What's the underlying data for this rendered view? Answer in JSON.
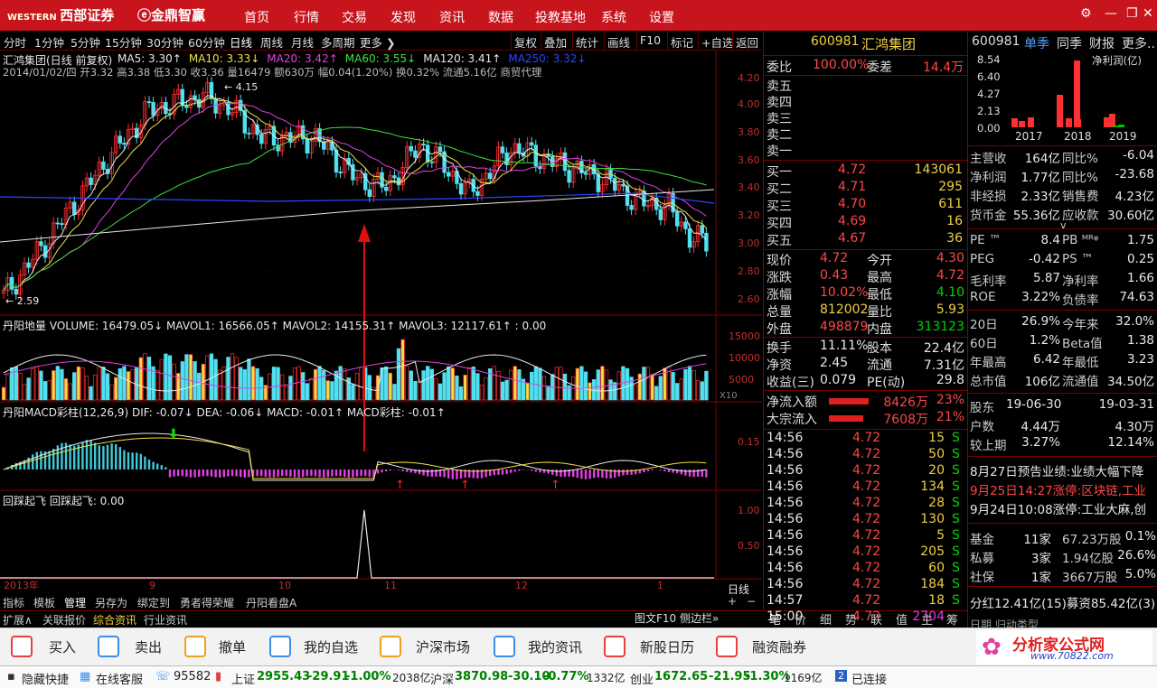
{
  "titlebar": {
    "brand1": "西部证券",
    "brand2": "金鼎智赢",
    "menus": [
      "首页",
      "行情",
      "交易",
      "发现",
      "资讯",
      "数据",
      "投教基地",
      "系统",
      "设置"
    ]
  },
  "periods": [
    "分时",
    "1分钟",
    "5分钟",
    "15分钟",
    "30分钟",
    "60分钟",
    "日线",
    "周线",
    "月线",
    "多周期",
    "更多"
  ],
  "tools": [
    "复权",
    "叠加",
    "统计",
    "画线",
    "F10",
    "标记",
    "+自选",
    "返回"
  ],
  "chart": {
    "info1": "汇鸿集团(日线 前复权)",
    "ma": [
      {
        "t": "MA5: 3.30",
        "c": "#e8e8e8"
      },
      {
        "t": "MA10: 3.33",
        "c": "#f0e040"
      },
      {
        "t": "MA20: 3.42",
        "c": "#e040e0"
      },
      {
        "t": "MA60: 3.55",
        "c": "#40e040"
      },
      {
        "t": "MA120: 3.41",
        "c": "#e8e8e8"
      },
      {
        "t": "MA250: 3.32",
        "c": "#2848ff"
      }
    ],
    "info2": "2014/01/02/四 开3.32 高3.38 低3.30 收3.36 量16479 额630万 幅0.04(1.20%) 换0.32% 流通5.16亿 商贸代理",
    "high_label": "4.15",
    "low_label": "2.59",
    "price_axis": [
      "4.20",
      "4.00",
      "3.80",
      "3.60",
      "3.40",
      "3.20",
      "3.00",
      "2.80",
      "2.60"
    ],
    "vol_title": "丹阳地量 VOLUME: 16479.05↓ MAVOL1: 16566.05↑ MAVOL2: 14155.31↑ MAVOL3: 12117.61↑ : 0.00",
    "vol_axis": [
      "15000",
      "10000",
      "5000",
      "X10"
    ],
    "macd_title": "丹阳MACD彩柱(12,26,9) DIF: -0.07↓ DEA: -0.06↓ MACD: -0.01↑ MACD彩柱: -0.01↑",
    "macd_axis": [
      "0.15"
    ],
    "fly_title": "回踩起飞 回踩起飞: 0.00",
    "fly_axis": [
      "1.00",
      "0.50"
    ],
    "dates": [
      "2013年",
      "9",
      "10",
      "11",
      "12",
      "1"
    ],
    "period_label": "日线"
  },
  "bottomtabs": [
    "指标",
    "模板",
    "管理",
    "另存为",
    "绑定到",
    "勇者得荣耀",
    "丹阳看盘A"
  ],
  "subtabs": [
    "扩展∧",
    "关联报价",
    "综合资讯",
    "行业资讯"
  ],
  "quote": {
    "code": "600981",
    "name": "汇鸿集团",
    "weibi": "委比",
    "weibi_val": "100.00%",
    "weicha": "委差",
    "weicha_val": "14.4万",
    "sells": [
      "卖五",
      "卖四",
      "卖三",
      "卖二",
      "卖一"
    ],
    "buys": [
      {
        "l": "买一",
        "p": "4.72",
        "v": "143061"
      },
      {
        "l": "买二",
        "p": "4.71",
        "v": "295"
      },
      {
        "l": "买三",
        "p": "4.70",
        "v": "611"
      },
      {
        "l": "买四",
        "p": "4.69",
        "v": "16"
      },
      {
        "l": "买五",
        "p": "4.67",
        "v": "36"
      }
    ],
    "stats": [
      {
        "a": "现价",
        "av": "4.72",
        "ac": "red",
        "b": "今开",
        "bv": "4.30",
        "bc": "red"
      },
      {
        "a": "涨跌",
        "av": "0.43",
        "ac": "red",
        "b": "最高",
        "bv": "4.72",
        "bc": "red"
      },
      {
        "a": "涨幅",
        "av": "10.02%",
        "ac": "red",
        "b": "最低",
        "bv": "4.10",
        "bc": "green"
      },
      {
        "a": "总量",
        "av": "812002",
        "ac": "yellow",
        "b": "量比",
        "bv": "5.93",
        "bc": "yellow"
      },
      {
        "a": "外盘",
        "av": "498879",
        "ac": "red",
        "b": "内盘",
        "bv": "313123",
        "bc": "green"
      }
    ],
    "stats2": [
      {
        "a": "换手",
        "av": "11.11%",
        "b": "股本",
        "bv": "22.4亿"
      },
      {
        "a": "净资",
        "av": "2.45",
        "b": "流通",
        "bv": "7.31亿"
      },
      {
        "a": "收益(三)",
        "av": "0.079",
        "b": "PE(动)",
        "bv": "29.8"
      }
    ],
    "flows": [
      {
        "l": "净流入额",
        "v": "8426万",
        "p": "23%"
      },
      {
        "l": "大宗流入",
        "v": "7608万",
        "p": "21%"
      }
    ],
    "ticks": [
      {
        "t": "14:56",
        "p": "4.72",
        "v": "15",
        "s": "S"
      },
      {
        "t": "14:56",
        "p": "4.72",
        "v": "50",
        "s": "S"
      },
      {
        "t": "14:56",
        "p": "4.72",
        "v": "20",
        "s": "S"
      },
      {
        "t": "14:56",
        "p": "4.72",
        "v": "134",
        "s": "S"
      },
      {
        "t": "14:56",
        "p": "4.72",
        "v": "28",
        "s": "S"
      },
      {
        "t": "14:56",
        "p": "4.72",
        "v": "130",
        "s": "S"
      },
      {
        "t": "14:56",
        "p": "4.72",
        "v": "5",
        "s": "S"
      },
      {
        "t": "14:56",
        "p": "4.72",
        "v": "205",
        "s": "S"
      },
      {
        "t": "14:56",
        "p": "4.72",
        "v": "60",
        "s": "S"
      },
      {
        "t": "14:56",
        "p": "4.72",
        "v": "184",
        "s": "S"
      },
      {
        "t": "14:57",
        "p": "4.72",
        "v": "18",
        "s": "S"
      },
      {
        "t": "15:00",
        "p": "4.72",
        "v": "2704",
        "s": ""
      }
    ],
    "tabs": [
      "笔",
      "价",
      "细",
      "势",
      "联",
      "值",
      "主",
      "筹"
    ],
    "sidebar_label": "图文F10 侧边栏»"
  },
  "fin": {
    "header": [
      "600981",
      "单季",
      "同季",
      "财报",
      "更多.."
    ],
    "chart_title": "净利润(亿)",
    "chart_data": {
      "type": "bar",
      "yticks": [
        "8.54",
        "6.40",
        "4.27",
        "2.13",
        "0.00"
      ],
      "categories": [
        "2017",
        "2018",
        "2019"
      ],
      "values": [
        1.1,
        0.8,
        1.2,
        4.0,
        1.1,
        1.0,
        8.3,
        1.2,
        1.7,
        0.2,
        0.3
      ],
      "colors": [
        "#ff3030",
        "#ff3030",
        "#ff3030",
        "#ff3030",
        "#ff3030",
        "#ff3030",
        "#ff3030",
        "#ff3030",
        "#ff3030",
        "#00c000",
        "#00c000"
      ]
    },
    "rows1": [
      {
        "a": "主营收",
        "av": "164亿",
        "b": "同比%",
        "bv": "-6.04"
      },
      {
        "a": "净利润",
        "av": "1.77亿",
        "b": "同比%",
        "bv": "-23.68"
      },
      {
        "a": "非经损",
        "av": "2.33亿",
        "b": "销售费",
        "bv": "4.23亿"
      },
      {
        "a": "货币金",
        "av": "55.36亿",
        "b": "应收款",
        "bv": "30.60亿"
      }
    ],
    "rows2": [
      {
        "a": "PE ™",
        "av": "8.4",
        "b": "PB ᴹᴿᵠ",
        "bv": "1.75"
      },
      {
        "a": "PEG",
        "av": "-0.42",
        "b": "PS ™",
        "bv": "0.25"
      },
      {
        "a": "毛利率",
        "av": "5.87",
        "b": "净利率",
        "bv": "1.66"
      },
      {
        "a": "ROE",
        "av": "3.22%",
        "b": "负债率",
        "bv": "74.63"
      }
    ],
    "rows3": [
      {
        "a": "20日",
        "av": "26.9%",
        "b": "今年来",
        "bv": "32.0%"
      },
      {
        "a": "60日",
        "av": "1.2%",
        "b": "Beta值",
        "bv": "1.38"
      },
      {
        "a": "年最高",
        "av": "6.42",
        "b": "年最低",
        "bv": "3.23"
      },
      {
        "a": "总市值",
        "av": "106亿",
        "b": "流通值",
        "bv": "34.50亿"
      }
    ],
    "rows4": [
      {
        "a": "股东",
        "av": "19-06-30",
        "b": "",
        "bv": "19-03-31"
      },
      {
        "a": "户数",
        "av": "4.44万",
        "b": "",
        "bv": "4.30万"
      },
      {
        "a": "较上期",
        "av": "3.27%",
        "b": "",
        "bv": "12.14%"
      }
    ],
    "news": [
      {
        "t": "8月27日预告业绩:业绩大幅下降",
        "c": "#e8e8e8"
      },
      {
        "t": "9月25日14:27涨停:区块链,工业",
        "c": "#ff4646"
      },
      {
        "t": "9月24日10:08涨停:工业大麻,创",
        "c": "#e8e8e8"
      }
    ],
    "rows5": [
      {
        "a": "基金",
        "av": "11家",
        "b": "67.23万股",
        "bv": "0.1%"
      },
      {
        "a": "私募",
        "av": "3家",
        "b": "1.94亿股",
        "bv": "26.6%"
      },
      {
        "a": "社保",
        "av": "1家",
        "b": "3667万股",
        "bv": "5.0%"
      }
    ],
    "footer": "分红12.41亿(15)募资85.42亿(3)",
    "footer2": "日期 归动类型"
  },
  "actions": [
    {
      "t": "买入",
      "c": "#e84040"
    },
    {
      "t": "卖出",
      "c": "#3a8ee8"
    },
    {
      "t": "撤单",
      "c": "#f0a020"
    },
    {
      "t": "我的自选",
      "c": "#3a8ee8"
    },
    {
      "t": "沪深市场",
      "c": "#f0a020"
    },
    {
      "t": "我的资讯",
      "c": "#3a8ee8"
    },
    {
      "t": "新股日历",
      "c": "#e84040"
    },
    {
      "t": "融资融券",
      "c": "#e84040"
    }
  ],
  "watermark": "分析家公式网",
  "watermark_url": "www.70822.com",
  "status": {
    "hide": "隐藏快捷",
    "service": "在线客服",
    "phone": "95582",
    "idx": [
      {
        "n": "上证",
        "v": "2955.43",
        "d": "-29.91",
        "p": "-1.00%",
        "a": "2038亿"
      },
      {
        "n": "沪深",
        "v": "3870.98",
        "d": "-30.10",
        "p": "-0.77%",
        "a": "1332亿"
      },
      {
        "n": "创业",
        "v": "1672.65",
        "d": "-21.95",
        "p": "-1.30%",
        "a": "1169亿"
      }
    ],
    "conn": "已连接",
    "conn_n": "2"
  }
}
